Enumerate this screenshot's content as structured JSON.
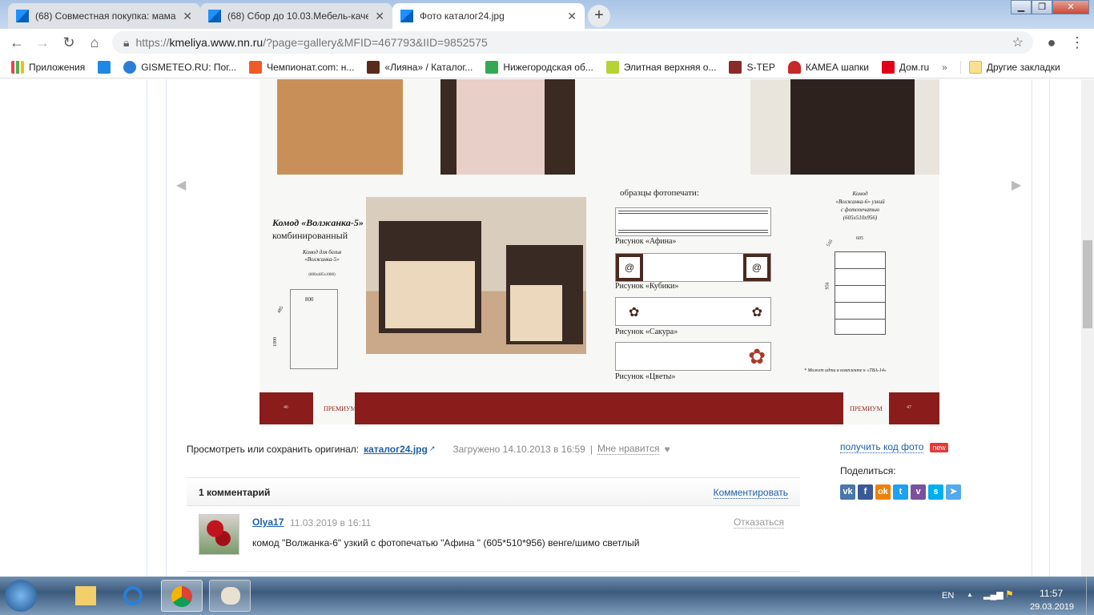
{
  "tabs": [
    {
      "title": "(68) Совместная покупка: мама"
    },
    {
      "title": "(68) Сбор до 10.03.Мебель-каче"
    },
    {
      "title": "Фото каталог24.jpg"
    }
  ],
  "url": {
    "scheme": "https://",
    "host": "kmeliya.www.nn.ru",
    "path": "/?page=gallery&MFID=467793&IID=9852575"
  },
  "bookmarks": [
    {
      "label": "Приложения",
      "color": "#e44"
    },
    {
      "label": "",
      "color": "#1e88e5"
    },
    {
      "label": "GISMETEO.RU: Пог...",
      "color": "#2a7fd4"
    },
    {
      "label": "Чемпионат.com: н...",
      "color": "#f05a28"
    },
    {
      "label": "«Лияна» / Каталог...",
      "color": "#5a2a1a"
    },
    {
      "label": "Нижегородская об...",
      "color": "#34a853"
    },
    {
      "label": "Элитная верхняя о...",
      "color": "#b5d334"
    },
    {
      "label": "S-TEP",
      "color": "#8b2a2a"
    },
    {
      "label": "КАМЕА  шапки",
      "color": "#c62828"
    },
    {
      "label": "Дом.ru",
      "color": "#e0001a"
    }
  ],
  "bookmarks_more": "»",
  "other_bookmarks": "Другие закладки",
  "catalog": {
    "left_title": "Комод «Волжанка-5»",
    "left_subtitle": "комбинированный",
    "left_desc1": "Комод для белья",
    "left_desc2": "«Волжанка-5»",
    "left_dims": "(800x485x1000)",
    "dim_800": "800",
    "dim_485": "485",
    "dim_1000": "1000",
    "samples_title": "образцы фотопечати:",
    "samples": [
      "Рисунок «Афина»",
      "Рисунок «Кубики»",
      "Рисунок «Сакура»",
      "Рисунок «Цветы»"
    ],
    "right_title1": "Комод",
    "right_title2": "«Волжанка-6» узкий",
    "right_title3": "с фотопечатью",
    "right_title4": "(605x510x956)",
    "dim_605": "605",
    "dim_510": "510",
    "dim_956": "956",
    "note": "* Может идти в комплекте к «ТВА-14»",
    "brand": "ПРЕМИУМ",
    "page_left": "46",
    "page_right": "47"
  },
  "info": {
    "label": "Просмотреть или сохранить оригинал:",
    "file": "каталог24.jpg",
    "uploaded": "Загружено 14.10.2013 в 16:59",
    "sep": "|",
    "like": "Мне нравится"
  },
  "side": {
    "get_code": "получить код фото",
    "new_badge": "new",
    "share": "Поделиться:",
    "share_icons": [
      {
        "name": "vk",
        "glyph": "vk",
        "color": "#4a76a8"
      },
      {
        "name": "facebook",
        "glyph": "f",
        "color": "#3b5998"
      },
      {
        "name": "odnoklassniki",
        "glyph": "ok",
        "color": "#ee8208"
      },
      {
        "name": "twitter",
        "glyph": "t",
        "color": "#1da1f2"
      },
      {
        "name": "viber",
        "glyph": "v",
        "color": "#7b519d"
      },
      {
        "name": "skype",
        "glyph": "s",
        "color": "#00aff0"
      },
      {
        "name": "telegram",
        "glyph": "➤",
        "color": "#54a9eb"
      }
    ]
  },
  "comments": {
    "count": "1 комментарий",
    "add": "Комментировать",
    "items": [
      {
        "author": "Olya17",
        "date": "11.03.2019 в 16:11",
        "action": "Отказаться",
        "text": "комод \"Волжанка-6\" узкий с фотопечатью \"Афина \" (605*510*956) венге/шимо светлый"
      }
    ]
  },
  "tray": {
    "lang": "EN",
    "time": "11:57",
    "date": "29.03.2019"
  }
}
